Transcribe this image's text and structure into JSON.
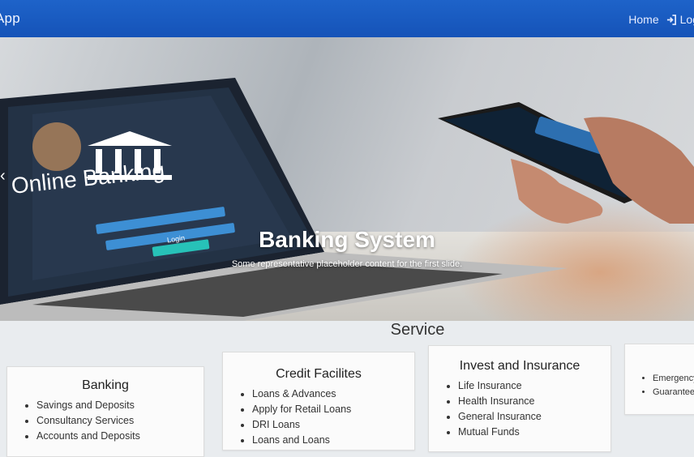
{
  "navbar": {
    "brand": "App",
    "links": {
      "home": "Home",
      "login": "Log"
    }
  },
  "carousel": {
    "laptop_text": "Online Banking",
    "login_button": "Login",
    "caption_title": "Banking System",
    "caption_text": "Some representative placeholder content for the first slide."
  },
  "services": {
    "title": "Service",
    "cards": [
      {
        "title": "Banking",
        "items": [
          "Savings and Deposits",
          "Consultancy Services",
          "Accounts and Deposits"
        ]
      },
      {
        "title": "Credit Facilites",
        "items": [
          "Loans & Advances",
          "Apply for Retail Loans",
          "DRI Loans",
          "Loans and Loans"
        ]
      },
      {
        "title": "Invest and Insurance",
        "items": [
          "Life Insurance",
          "Health Insurance",
          "General Insurance",
          "Mutual Funds"
        ]
      },
      {
        "title": "",
        "items": [
          "Emergency",
          "Guarantee"
        ]
      }
    ]
  }
}
